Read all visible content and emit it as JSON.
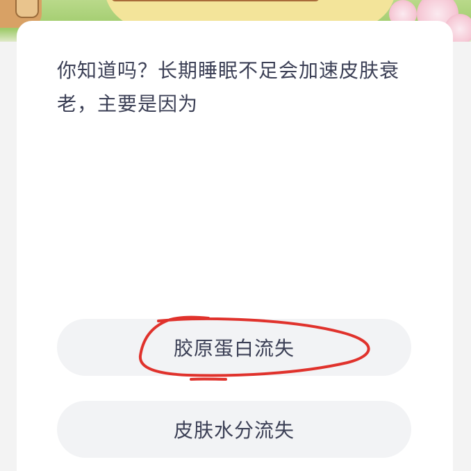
{
  "quiz": {
    "question": "你知道吗？长期睡眠不足会加速皮肤衰老，主要是因为",
    "options": [
      {
        "label": "胶原蛋白流失",
        "circled": true
      },
      {
        "label": "皮肤水分流失",
        "circled": false
      }
    ]
  },
  "colors": {
    "text": "#3b3f55",
    "option_bg": "#f2f3f5",
    "card_bg": "#ffffff",
    "page_bg": "#f3f3f3",
    "annotation": "#e0322c"
  }
}
